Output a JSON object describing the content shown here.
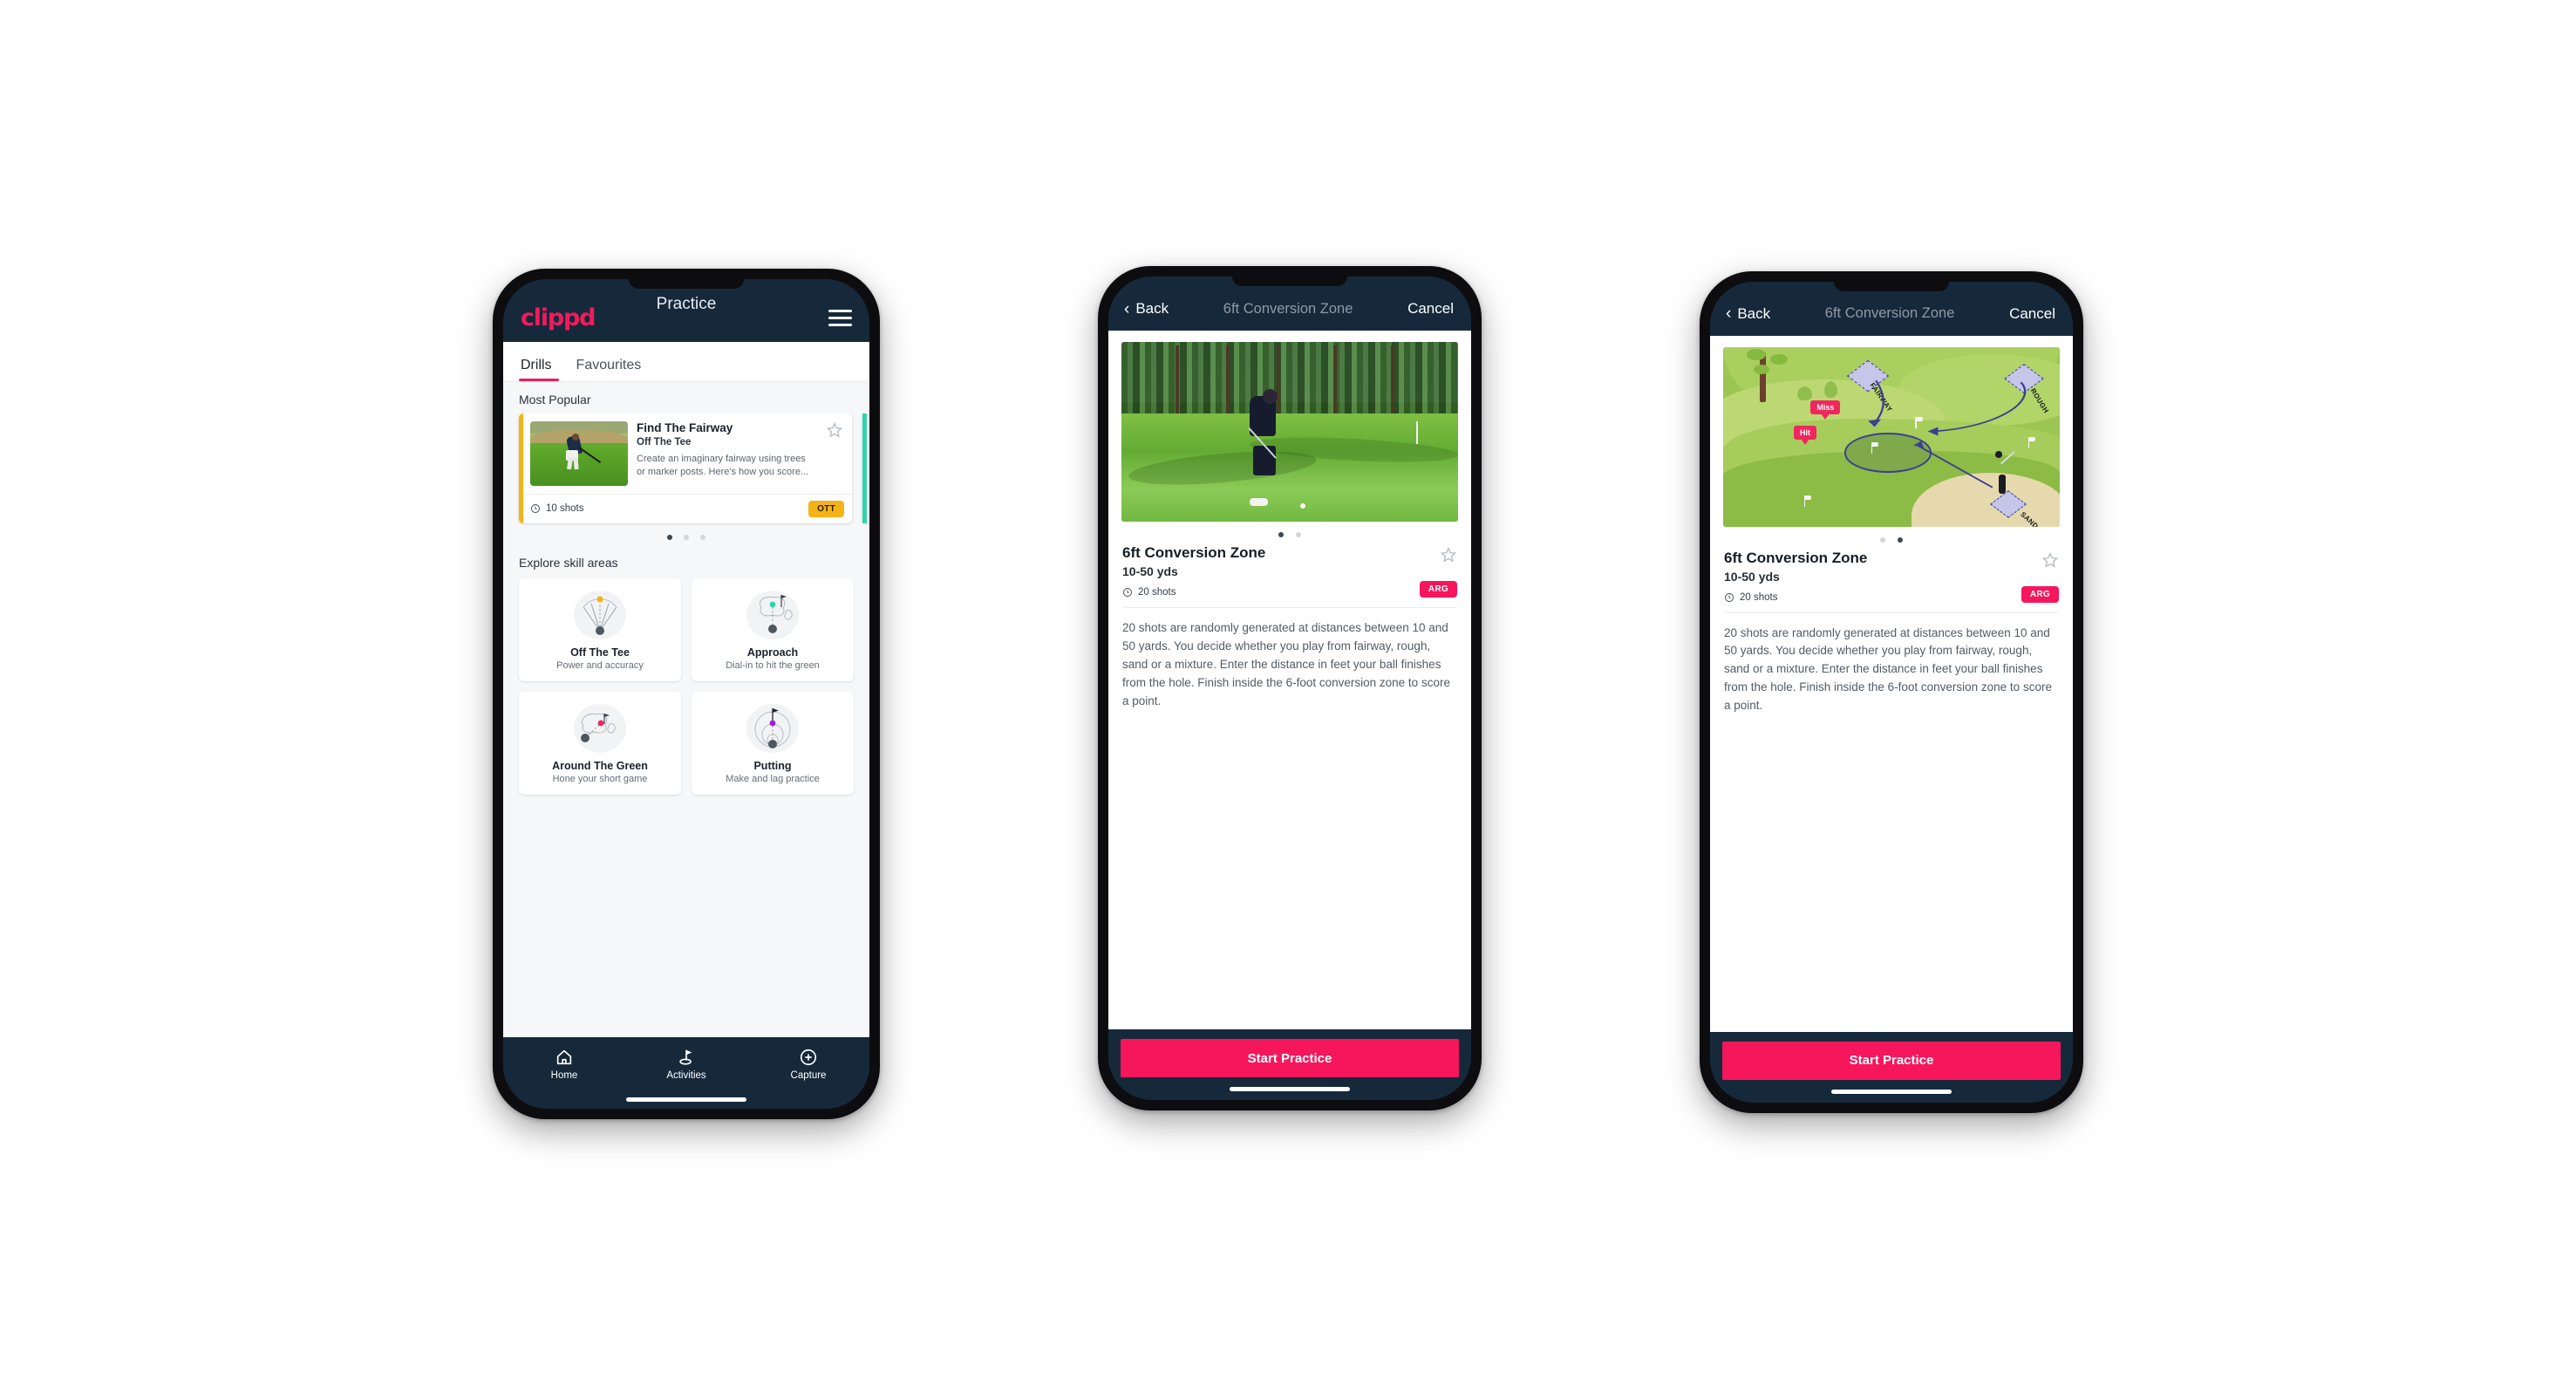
{
  "app": {
    "brand": "clippd",
    "accent": "#ef1b5c",
    "dark_bar": "#16293b"
  },
  "phone1": {
    "appbar": {
      "title": "Practice",
      "menu_icon": "hamburger-menu-icon"
    },
    "tabs": [
      {
        "label": "Drills",
        "active": true
      },
      {
        "label": "Favourites",
        "active": false
      }
    ],
    "most_popular": {
      "heading": "Most Popular"
    },
    "drill_card": {
      "title": "Find The Fairway",
      "subtitle": "Off The Tee",
      "description": "Create an imaginary fairway using trees or marker posts. Here's how you score...",
      "shots": "10 shots",
      "badge": "OTT",
      "badge_color": "#f5b317",
      "accent_color": "#f5b317",
      "next_accent_color": "#2fd4ad",
      "star_icon": "star-outline-icon",
      "clock_icon": "clock-icon"
    },
    "carousel_dots": {
      "count": 3,
      "active_index": 0
    },
    "explore": {
      "heading": "Explore skill areas"
    },
    "skills": [
      {
        "name": "Off The Tee",
        "desc": "Power and accuracy",
        "icon": "off-the-tee-fan-icon",
        "dot_color": "#f5b317"
      },
      {
        "name": "Approach",
        "desc": "Dial-in to hit the green",
        "icon": "approach-green-icon",
        "dot_color": "#2fd4ad"
      },
      {
        "name": "Around The Green",
        "desc": "Hone your short game",
        "icon": "around-the-green-icon",
        "dot_color": "#f0275e"
      },
      {
        "name": "Putting",
        "desc": "Make and lag practice",
        "icon": "putting-rings-icon",
        "dot_color": "#a021d6"
      }
    ],
    "bottom_nav": [
      {
        "label": "Home",
        "icon": "home-icon",
        "active": false
      },
      {
        "label": "Activities",
        "icon": "golf-flag-icon",
        "active": true
      },
      {
        "label": "Capture",
        "icon": "plus-circle-icon",
        "active": false
      }
    ]
  },
  "phone2": {
    "appbar": {
      "back": "Back",
      "title": "6ft Conversion Zone",
      "cancel": "Cancel",
      "back_icon": "chevron-left-icon"
    },
    "media": {
      "type": "photo",
      "alt": "golfer-chipping-photo"
    },
    "carousel_dots": {
      "count": 2,
      "active_index": 0
    },
    "detail": {
      "title": "6ft Conversion Zone",
      "distance": "10-50 yds",
      "shots": "20 shots",
      "badge": "ARG",
      "badge_color": "#f5165c",
      "star_icon": "star-outline-icon",
      "clock_icon": "clock-icon",
      "description": "20 shots are randomly generated at distances between 10 and 50 yards. You decide whether you play from fairway, rough, sand or a mixture. Enter the distance in feet your ball finishes from the hole. Finish inside the 6-foot conversion zone to score a point."
    },
    "cta": {
      "label": "Start Practice",
      "color": "#f5165c"
    }
  },
  "phone3": {
    "appbar": {
      "back": "Back",
      "title": "6ft Conversion Zone",
      "cancel": "Cancel",
      "back_icon": "chevron-left-icon"
    },
    "media": {
      "type": "illustration",
      "alt": "golf-course-diagram",
      "zone_labels": [
        "FAIRWAY",
        "ROUGH",
        "SAND"
      ],
      "markers": [
        "Miss",
        "Hit"
      ],
      "marker_color": "#f0275e"
    },
    "carousel_dots": {
      "count": 2,
      "active_index": 1
    },
    "detail": {
      "title": "6ft Conversion Zone",
      "distance": "10-50 yds",
      "shots": "20 shots",
      "badge": "ARG",
      "badge_color": "#f5165c",
      "star_icon": "star-outline-icon",
      "clock_icon": "clock-icon",
      "description": "20 shots are randomly generated at distances between 10 and 50 yards. You decide whether you play from fairway, rough, sand or a mixture. Enter the distance in feet your ball finishes from the hole. Finish inside the 6-foot conversion zone to score a point."
    },
    "cta": {
      "label": "Start Practice",
      "color": "#f5165c"
    }
  }
}
